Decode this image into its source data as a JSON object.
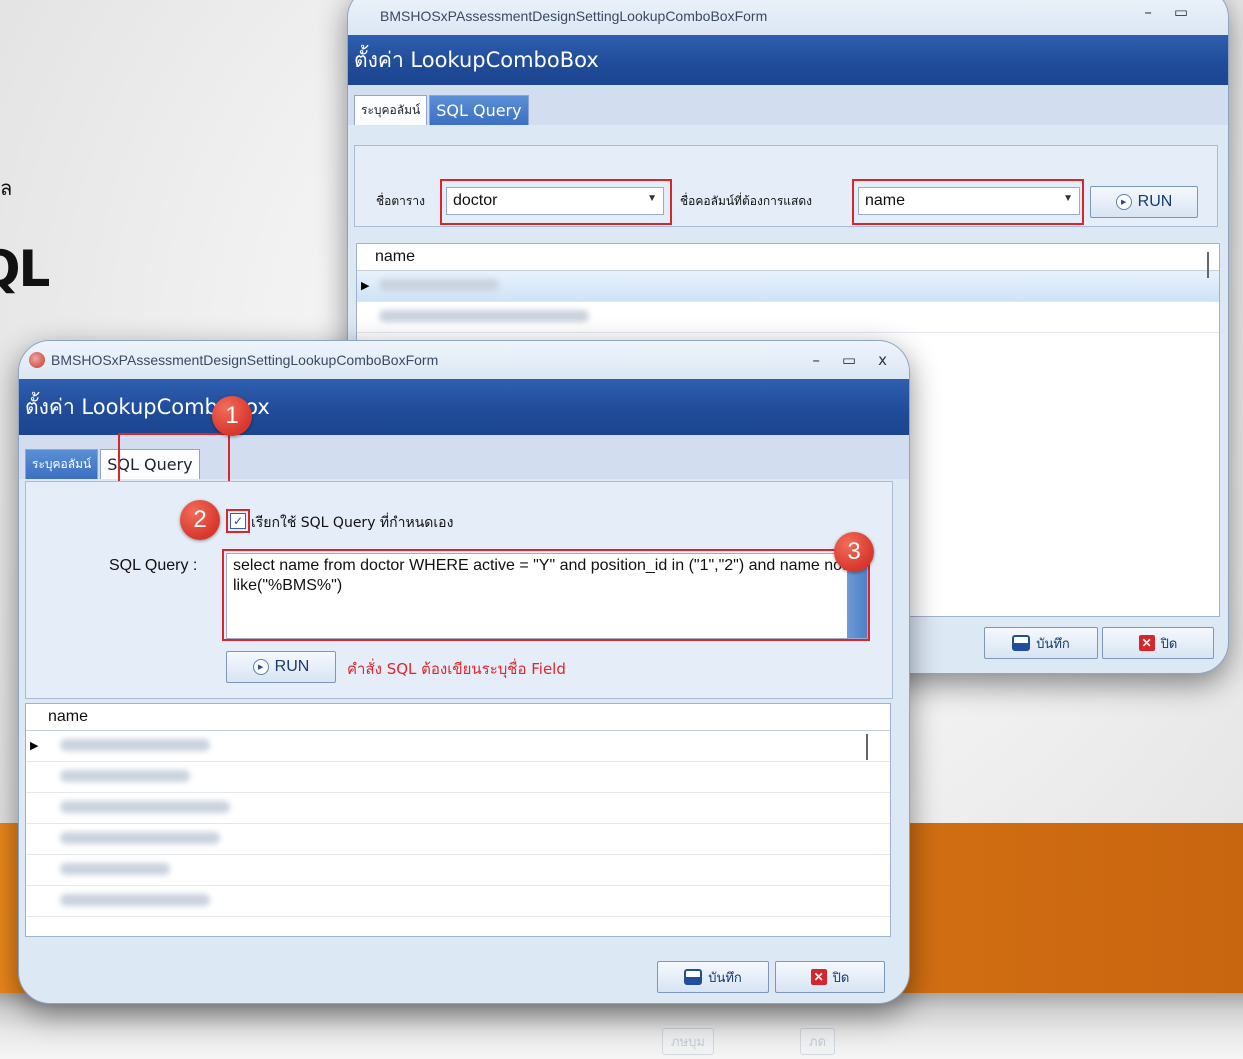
{
  "background": {
    "left_fragment_small": "ล",
    "left_fragment_large": "QL",
    "reflection": {
      "save": "ภษบุม",
      "close": "ภด"
    }
  },
  "back_window": {
    "title": "BMSHOSxPAssessmentDesignSettingLookupComboBoxForm",
    "header": "ตั้งค่า LookupComboBox",
    "tabs": [
      "ระบุคอลัมน์",
      "SQL Query"
    ],
    "table_label": "ชื่อตาราง",
    "table_value": "doctor",
    "column_label": "ชื่อคอลัมน์ที่ต้องการแสดง",
    "column_value": "name",
    "run_label": "RUN",
    "grid_header": "name",
    "save_label": "บันทึก",
    "close_label": "ปิด",
    "minimize": "–",
    "maximize": "▭"
  },
  "front_window": {
    "title": "BMSHOSxPAssessmentDesignSettingLookupComboBoxForm",
    "header": "ตั้งค่า LookupComboBox",
    "tabs": [
      "ระบุคอลัมน์",
      "SQL Query"
    ],
    "checkbox_label": "เรียกใช้ SQL Query ที่กำหนดเอง",
    "checkbox_checked": true,
    "sql_label": "SQL Query :",
    "sql_text": "select name from doctor  WHERE active = \"Y\"   and position_id in (\"1\",\"2\") and name not like(\"%BMS%\")",
    "run_label": "RUN",
    "hint": "คำสั่ง SQL ต้องเขียนระบุชื่อ Field",
    "grid_header": "name",
    "save_label": "บันทึก",
    "close_label": "ปิด",
    "minimize": "–",
    "maximize": "▭",
    "close_x": "x"
  },
  "badges": [
    "1",
    "2",
    "3"
  ],
  "colors": {
    "accent_red": "#d9262b",
    "header_blue": "#1f4b98",
    "hint_red": "#e0262b",
    "orange": "#e9861c"
  }
}
